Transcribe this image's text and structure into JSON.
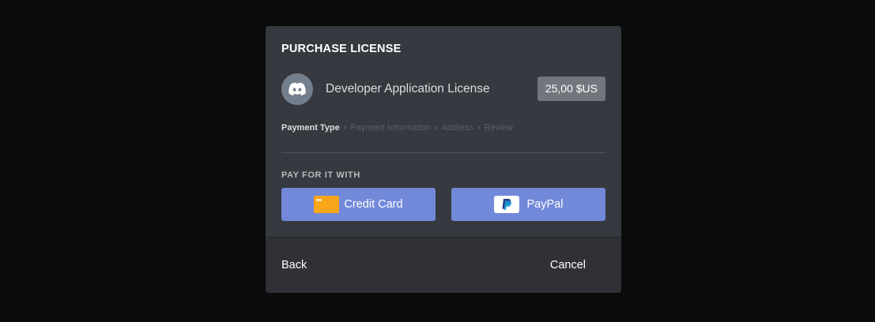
{
  "modal": {
    "title": "PURCHASE LICENSE"
  },
  "product": {
    "icon": "discord-logo-icon",
    "name": "Developer Application License",
    "price": "25,00 $US"
  },
  "breadcrumb": {
    "steps": [
      "Payment Type",
      "Payment Information",
      "Address",
      "Review"
    ],
    "active_index": 0
  },
  "payment": {
    "section_label": "PAY FOR IT WITH",
    "options": [
      {
        "label": "Credit Card",
        "icon": "credit-card-icon"
      },
      {
        "label": "PayPal",
        "icon": "paypal-icon"
      }
    ]
  },
  "footer": {
    "back_label": "Back",
    "cancel_label": "Cancel"
  },
  "colors": {
    "background": "#0a0b0b",
    "modal": "#36393f",
    "footer": "#2f3136",
    "accent_blurple": "#7289da",
    "card_orange": "#faa61a",
    "avatar_gray": "#747f8d",
    "price_badge": "#72767d"
  }
}
